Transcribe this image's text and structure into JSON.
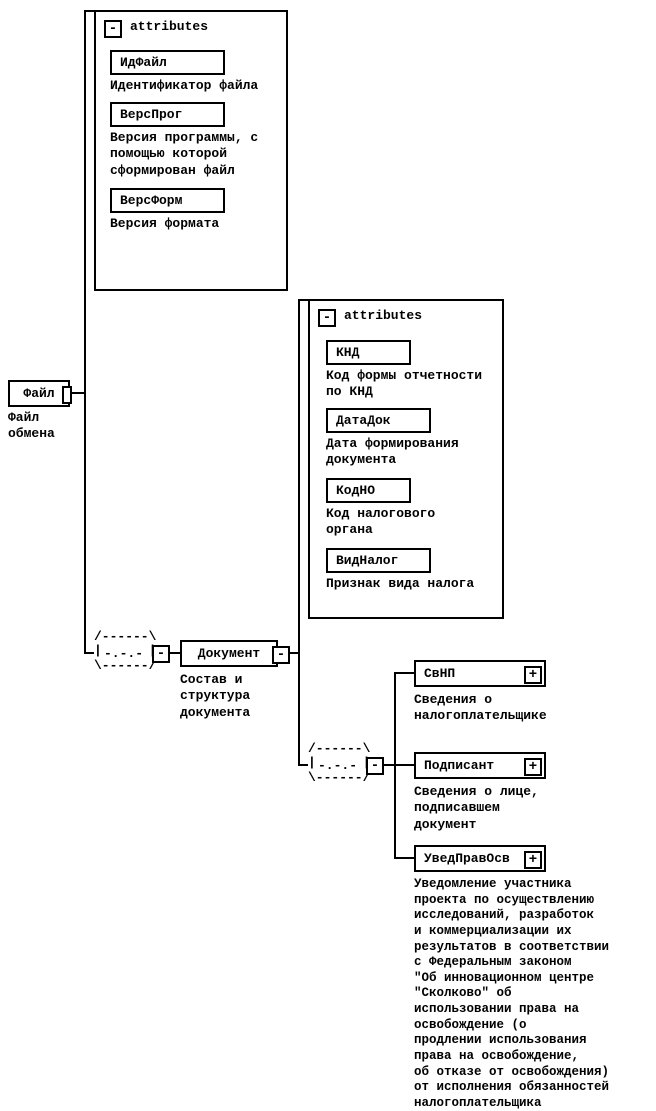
{
  "root": {
    "label": "Файл",
    "desc": "Файл\nобмена"
  },
  "attrs1": {
    "header": "attributes",
    "items": [
      {
        "label": "ИдФайл",
        "desc": "Идентификатор файла"
      },
      {
        "label": "ВерсПрог",
        "desc": "Версия программы, с\nпомощью которой\nсформирован файл"
      },
      {
        "label": "ВерсФорм",
        "desc": "Версия формата"
      }
    ]
  },
  "doc": {
    "label": "Документ",
    "desc": "Состав и\nструктура\nдокумента"
  },
  "attrs2": {
    "header": "attributes",
    "items": [
      {
        "label": "КНД",
        "desc": "Код формы отчетности\nпо КНД"
      },
      {
        "label": "ДатаДок",
        "desc": "Дата формирования\nдокумента"
      },
      {
        "label": "КодНО",
        "desc": "Код налогового\nоргана"
      },
      {
        "label": "ВидНалог",
        "desc": "Признак вида налога"
      }
    ]
  },
  "children": {
    "svnp": {
      "label": "СвНП",
      "desc": "Сведения о\nналогоплательщике"
    },
    "podp": {
      "label": "Подписант",
      "desc": "Сведения о лице,\nподписавшем\nдокумент"
    },
    "uved": {
      "label": "УведПравОсв",
      "desc": "Уведомление участника\nпроекта по осуществлению\nисследований, разработок\nи коммерциализации их\nрезультатов в соответствии\nс Федеральным законом\n\"Об инновационном центре\n\"Сколково\" об\nиспользовании права на\nосвобождение (о\nпродлении использования\nправа на освобождение,\nоб отказе от освобождения)\nот исполнения обязанностей\nналогоплательщика"
    }
  },
  "seq_marker": "-.-.-"
}
